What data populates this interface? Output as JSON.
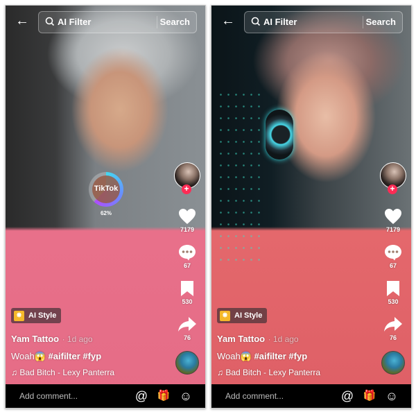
{
  "panels": [
    {
      "id": "original",
      "search": {
        "query": "AI Filter",
        "button": "Search"
      },
      "progress": {
        "brand": "TikTok",
        "percent_label": "62%",
        "value": 0.62
      },
      "actions": {
        "likes": "7179",
        "comments": "67",
        "saves": "530",
        "shares": "76"
      },
      "style_badge": "AI Style",
      "author": "Yam Tattoo",
      "posted": "· 1d ago",
      "caption_text": "Woah😱",
      "caption_tags": "#aifilter #fyp",
      "music_note": "♫",
      "music": "Bad Bitch - Lexy Panterra",
      "comment_placeholder": "Add comment...",
      "icons": {
        "back": "←",
        "mention": "@",
        "gift": "🎁",
        "emoji": "☺",
        "follow": "+"
      }
    },
    {
      "id": "ai-filtered",
      "search": {
        "query": "AI Filter",
        "button": "Search"
      },
      "actions": {
        "likes": "7179",
        "comments": "67",
        "saves": "530",
        "shares": "76"
      },
      "style_badge": "AI Style",
      "author": "Yam Tattoo",
      "posted": "· 1d ago",
      "caption_text": "Woah😱",
      "caption_tags": "#aifilter #fyp",
      "music_note": "♫",
      "music": "Bad Bitch - Lexy Panterra",
      "comment_placeholder": "Add comment...",
      "icons": {
        "back": "←",
        "mention": "@",
        "gift": "🎁",
        "emoji": "☺",
        "follow": "+"
      }
    }
  ],
  "colors": {
    "follow": "#fe2c55",
    "badge_icon": "#f5b82a",
    "comment_bar": "#000000"
  }
}
